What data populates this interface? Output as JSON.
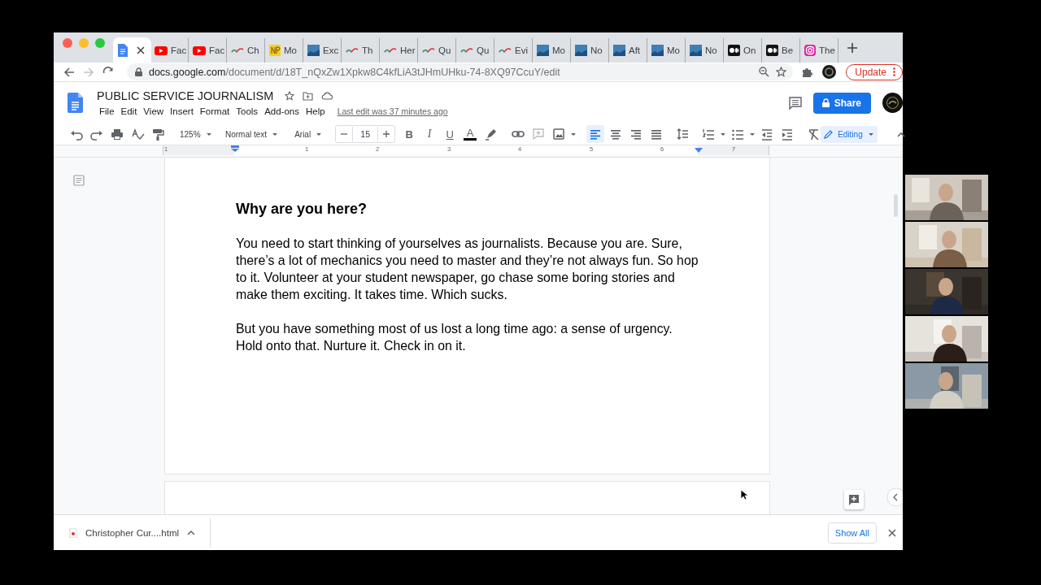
{
  "browser": {
    "tabs": [
      {
        "kind": "docs",
        "selected": true
      },
      {
        "kind": "youtube",
        "label": "Fac",
        "selected": false
      },
      {
        "kind": "youtube",
        "label": "Fac",
        "selected": false
      },
      {
        "kind": "wave",
        "label": "Ch",
        "selected": false
      },
      {
        "kind": "np",
        "label": "Mo",
        "selected": false
      },
      {
        "kind": "thumb",
        "label": "Exc",
        "selected": false
      },
      {
        "kind": "wave",
        "label": "Th",
        "selected": false
      },
      {
        "kind": "wave",
        "label": "Her",
        "selected": false
      },
      {
        "kind": "wave",
        "label": "Qu",
        "selected": false
      },
      {
        "kind": "wave",
        "label": "Qu",
        "selected": false
      },
      {
        "kind": "wave",
        "label": "Evi",
        "selected": false
      },
      {
        "kind": "thumb",
        "label": "Mo",
        "selected": false
      },
      {
        "kind": "thumb",
        "label": "No",
        "selected": false
      },
      {
        "kind": "thumb",
        "label": "Aft",
        "selected": false
      },
      {
        "kind": "thumb",
        "label": "Mo",
        "selected": false
      },
      {
        "kind": "thumb",
        "label": "No",
        "selected": false
      },
      {
        "kind": "medium",
        "label": "On",
        "selected": false
      },
      {
        "kind": "medium",
        "label": "Be",
        "selected": false
      },
      {
        "kind": "instagram",
        "label": "The",
        "selected": false
      }
    ],
    "url": {
      "host": "docs.google.com",
      "path": "/document/d/18T_nQxZw1Xpkw8C4kfLiA3tJHmUHku-74-8XQ97CcuY/edit"
    },
    "update_button": "Update"
  },
  "document": {
    "title": "PUBLIC SERVICE JOURNALISM",
    "menu": [
      "File",
      "Edit",
      "View",
      "Insert",
      "Format",
      "Tools",
      "Add-ons",
      "Help"
    ],
    "last_edit": "Last edit was 37 minutes ago",
    "share_button": "Share"
  },
  "toolbar": {
    "zoom": "125%",
    "style": "Normal text",
    "font": "Arial",
    "font_size": "15",
    "text_buttons": [
      {
        "kind": "bold",
        "label": "B"
      },
      {
        "kind": "italic",
        "label": "I"
      },
      {
        "kind": "underline",
        "label": "U"
      },
      {
        "kind": "color",
        "label": "A"
      }
    ],
    "align_buttons": [
      {
        "kind": "left",
        "selected": true
      },
      {
        "kind": "center",
        "selected": false
      },
      {
        "kind": "right",
        "selected": false
      },
      {
        "kind": "justify",
        "selected": false
      }
    ],
    "mode": "Editing"
  },
  "ruler": [
    "1",
    "1",
    "2",
    "3",
    "4",
    "5",
    "6",
    "7"
  ],
  "page": {
    "heading": "Why are you here?",
    "paragraphs": [
      "You need to start thinking of yourselves as journalists. Because you are. Sure, there’s a lot of mechanics you need to master and they’re not always fun. So hop to it. Volunteer at your student newspaper, go chase some boring stories and make them exciting. It takes time. Which sucks.",
      "But you have something most of us lost a long time ago: a sense of urgency. Hold onto that. Nurture it. Check in on it."
    ]
  },
  "downloads": {
    "file": "Christopher Cur....html",
    "show_all": "Show All"
  }
}
